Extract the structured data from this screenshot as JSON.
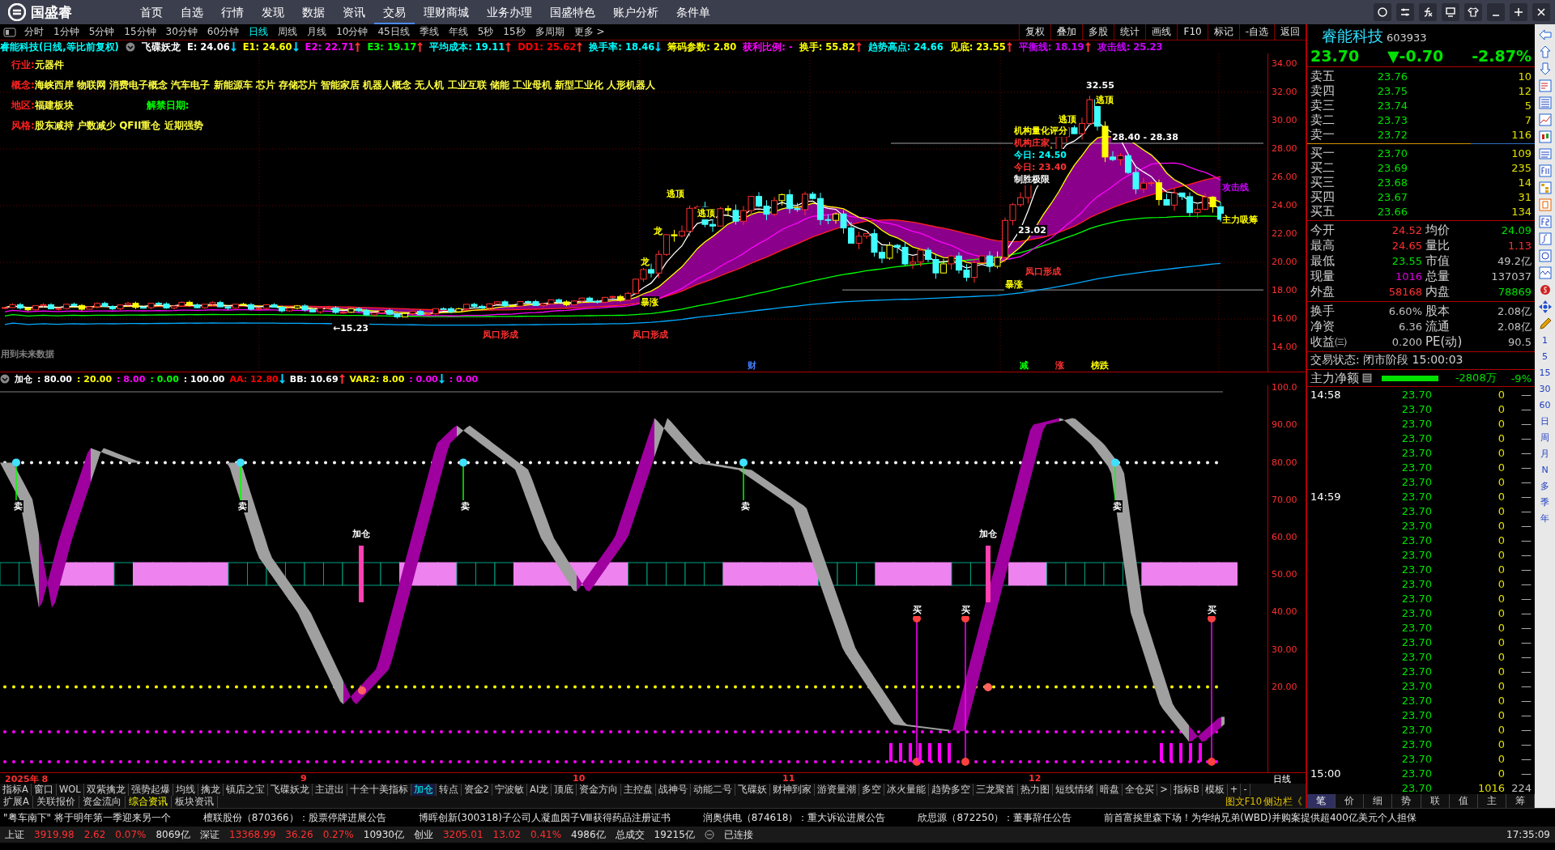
{
  "app": {
    "logo": "国盛睿"
  },
  "nav": [
    {
      "label": "首页",
      "selected": false
    },
    {
      "label": "自选",
      "selected": false
    },
    {
      "label": "行情",
      "selected": false
    },
    {
      "label": "发现",
      "selected": false
    },
    {
      "label": "数据",
      "selected": false
    },
    {
      "label": "资讯",
      "selected": false
    },
    {
      "label": "交易",
      "selected": true
    },
    {
      "label": "理财商城",
      "selected": false
    },
    {
      "label": "业务办理",
      "selected": false
    },
    {
      "label": "国盛特色",
      "selected": false
    },
    {
      "label": "账户分析",
      "selected": false
    },
    {
      "label": "条件单",
      "selected": false
    }
  ],
  "periods": [
    {
      "label": "分时",
      "selected": false
    },
    {
      "label": "1分钟",
      "selected": false
    },
    {
      "label": "5分钟",
      "selected": false
    },
    {
      "label": "15分钟",
      "selected": false
    },
    {
      "label": "30分钟",
      "selected": false
    },
    {
      "label": "60分钟",
      "selected": false
    },
    {
      "label": "日线",
      "selected": true
    },
    {
      "label": "周线",
      "selected": false
    },
    {
      "label": "月线",
      "selected": false
    },
    {
      "label": "10分钟",
      "selected": false
    },
    {
      "label": "45日线",
      "selected": false
    },
    {
      "label": "季线",
      "selected": false
    },
    {
      "label": "年线",
      "selected": false
    },
    {
      "label": "5秒",
      "selected": false
    },
    {
      "label": "15秒",
      "selected": false
    },
    {
      "label": "多周期",
      "selected": false
    },
    {
      "label": "更多 >",
      "selected": false
    }
  ],
  "chart_tools": [
    "复权",
    "叠加",
    "多股",
    "统计",
    "画线",
    "F10",
    "标记",
    "-自选",
    "返回"
  ],
  "info_bar": {
    "title": "睿能科技(日线,等比前复权)",
    "indicator": "飞碟妖龙",
    "items": [
      {
        "text": "E: 24.06",
        "color": "#ffffff",
        "rising": false
      },
      {
        "text": "E1: 24.60",
        "color": "#ffff00",
        "rising": false
      },
      {
        "text": "E2: 22.71",
        "color": "#ff00ff",
        "rising": true
      },
      {
        "text": "E3: 19.17",
        "color": "#00ff00",
        "rising": true
      },
      {
        "text": "平均成本: 19.11",
        "color": "#00ffff",
        "rising": true
      },
      {
        "text": "DD1: 25.62",
        "color": "#ff0000",
        "rising": true
      },
      {
        "text": "换手率: 18.46",
        "color": "#00ffff",
        "rising": false
      },
      {
        "text": "筹码参数: 2.80",
        "color": "#ffff00"
      },
      {
        "text": "获利比例: -",
        "color": "#ff00ff"
      },
      {
        "text": "换手: 55.82",
        "color": "#ffff00",
        "rising": true
      },
      {
        "text": "趋势高点: 24.66",
        "color": "#00ffff"
      },
      {
        "text": "见底: 23.55",
        "color": "#ffff00",
        "rising": true
      },
      {
        "text": "平衡线: 18.19",
        "color": "#cc00ff",
        "rising": true
      },
      {
        "text": "攻击线: 25.23",
        "color": "#cc00ff"
      }
    ]
  },
  "stock_tags": [
    {
      "label": "行业:",
      "value": "元器件"
    },
    {
      "label": "概念:",
      "value": "海峡西岸 物联网 消费电子概念 汽车电子 新能源车 芯片 存储芯片 智能家居 机器人概念 无人机 工业互联 储能 工业母机 新型工业化 人形机器人"
    },
    {
      "label": "地区:",
      "value": "福建板块",
      "extra": "解禁日期:"
    },
    {
      "label": "风格:",
      "value": "股东减持 户数减少 QFII重仓 近期强势"
    }
  ],
  "price_axis": [
    "34.00",
    "32.00",
    "30.00",
    "28.00",
    "26.00",
    "24.00",
    "22.00",
    "20.00",
    "18.00",
    "16.00",
    "14.00"
  ],
  "annotations": [
    {
      "text": "32.55",
      "color": "#ffffff"
    },
    {
      "text": "28.40 - 28.38",
      "color": "#ffffff"
    },
    {
      "text": "逃顶",
      "color": "#ffff00"
    },
    {
      "text": "逃顶",
      "color": "#ffff00"
    },
    {
      "text": "逃顶",
      "color": "#ffff00"
    },
    {
      "text": "逃顶",
      "color": "#ffff00"
    },
    {
      "text": "机构量化评分",
      "color": "#ffff00"
    },
    {
      "text": "机构庄家",
      "color": "#ff3030"
    },
    {
      "text": "今日: 24.50",
      "color": "#00ffff"
    },
    {
      "text": "今日: 23.40",
      "color": "#ff3030"
    },
    {
      "text": "制胜极限",
      "color": "#ffffff"
    },
    {
      "text": "攻击线",
      "color": "#cc00ff"
    },
    {
      "text": "主力吸筹",
      "color": "#ffff00"
    },
    {
      "text": "23.02",
      "color": "#ffffff"
    },
    {
      "text": "←15.23",
      "color": "#ffffff"
    },
    {
      "text": "凤口形成",
      "color": "#ff3030"
    },
    {
      "text": "凤口形成",
      "color": "#ff3030"
    },
    {
      "text": "凤口形成",
      "color": "#ff3030"
    },
    {
      "text": "暴涨",
      "color": "#ffff00"
    },
    {
      "text": "暴涨",
      "color": "#ffff00"
    },
    {
      "text": "龙",
      "color": "#ffff00"
    },
    {
      "text": "龙",
      "color": "#ffff00"
    },
    {
      "text": "用到未来数据",
      "color": "#808080"
    },
    {
      "text": "财",
      "color": "#4080ff"
    },
    {
      "text": "减",
      "color": "#00ff00"
    },
    {
      "text": "涨",
      "color": "#ff3030"
    },
    {
      "text": "榜跌",
      "color": "#ffff00"
    }
  ],
  "indicator_bar": {
    "name": "加仓",
    "items": [
      {
        "text": ": 80.00",
        "color": "#ffffff"
      },
      {
        "text": ": 20.00",
        "color": "#ffff00"
      },
      {
        "text": ": 8.00",
        "color": "#ff00ff"
      },
      {
        "text": ": 0.00",
        "color": "#00ff00"
      },
      {
        "text": ": 100.00",
        "color": "#ffffff"
      },
      {
        "text": "AA: 12.80",
        "color": "#ff0000",
        "rising": false
      },
      {
        "text": "BB: 10.69",
        "color": "#ffffff",
        "rising": true
      },
      {
        "text": "VAR2: 8.00",
        "color": "#ffff00"
      },
      {
        "text": ": 0.00",
        "color": "#ff00ff",
        "rising": false
      },
      {
        "text": ": 0.00",
        "color": "#ff00ff"
      }
    ]
  },
  "indicator_axis": [
    "100.0",
    "90.00",
    "80.00",
    "70.00",
    "60.00",
    "50.00",
    "40.00",
    "30.00",
    "20.00"
  ],
  "signals": [
    {
      "text": "卖",
      "kind": "sell"
    },
    {
      "text": "卖",
      "kind": "sell"
    },
    {
      "text": "卖",
      "kind": "sell"
    },
    {
      "text": "卖",
      "kind": "sell"
    },
    {
      "text": "卖",
      "kind": "sell"
    },
    {
      "text": "加仓",
      "kind": "add"
    },
    {
      "text": "加仓",
      "kind": "add"
    },
    {
      "text": "买",
      "kind": "buy"
    },
    {
      "text": "买",
      "kind": "buy"
    },
    {
      "text": "买",
      "kind": "buy"
    }
  ],
  "date_axis": [
    "2025年 8",
    "9",
    "10",
    "11",
    "12"
  ],
  "period_label": "日线",
  "indicator_tabs": [
    {
      "label": "指标A",
      "selected": false
    },
    {
      "label": "窗口",
      "selected": false
    },
    {
      "label": "WOL",
      "selected": false
    },
    {
      "label": "双紫擒龙",
      "selected": false
    },
    {
      "label": "强势起爆",
      "selected": false
    },
    {
      "label": "均线",
      "selected": false
    },
    {
      "label": "擒龙",
      "selected": false
    },
    {
      "label": "镇店之宝",
      "selected": false
    },
    {
      "label": "飞碟妖龙",
      "selected": false
    },
    {
      "label": "主进出",
      "selected": false
    },
    {
      "label": "十全十美指标",
      "selected": false
    },
    {
      "label": "加仓",
      "selected": true
    },
    {
      "label": "转点",
      "selected": false
    },
    {
      "label": "资金2",
      "selected": false
    },
    {
      "label": "宁波敏",
      "selected": false
    },
    {
      "label": "AI龙",
      "selected": false
    },
    {
      "label": "顶底",
      "selected": false
    },
    {
      "label": "资金方向",
      "selected": false
    },
    {
      "label": "主控盘",
      "selected": false
    },
    {
      "label": "战神号",
      "selected": false
    },
    {
      "label": "动能二号",
      "selected": false
    },
    {
      "label": "飞碟妖",
      "selected": false
    },
    {
      "label": "财神到家",
      "selected": false
    },
    {
      "label": "游资量潮",
      "selected": false
    },
    {
      "label": "多空",
      "selected": false
    },
    {
      "label": "冰火量能",
      "selected": false
    },
    {
      "label": "趋势多空",
      "selected": false
    },
    {
      "label": "三龙聚首",
      "selected": false
    },
    {
      "label": "热力图",
      "selected": false
    },
    {
      "label": "短线情绪",
      "selected": false
    },
    {
      "label": "暗盘",
      "selected": false
    },
    {
      "label": "全仓买",
      "selected": false
    },
    {
      "label": ">",
      "selected": false
    },
    {
      "label": "指标B",
      "selected": false
    },
    {
      "label": "模板",
      "selected": false
    },
    {
      "label": "+",
      "selected": false
    },
    {
      "label": "-",
      "selected": false
    }
  ],
  "info_tabs": [
    {
      "label": "扩展A",
      "selected": false
    },
    {
      "label": "关联报价",
      "selected": false
    },
    {
      "label": "资金流向",
      "selected": false
    },
    {
      "label": "综合资讯",
      "selected": true
    },
    {
      "label": "板块资讯",
      "selected": false
    }
  ],
  "info_tabs_right": [
    "图文F10",
    "侧边栏《"
  ],
  "quote": {
    "name": "睿能科技",
    "code": "603933",
    "price": "23.70",
    "change": "▼-0.70",
    "change_pct": "-2.87%",
    "asks": [
      {
        "label": "卖五",
        "price": "23.76",
        "volume": "10"
      },
      {
        "label": "卖四",
        "price": "23.75",
        "volume": "12"
      },
      {
        "label": "卖三",
        "price": "23.74",
        "volume": "5"
      },
      {
        "label": "卖二",
        "price": "23.73",
        "volume": "7"
      },
      {
        "label": "卖一",
        "price": "23.72",
        "volume": "116"
      }
    ],
    "bids": [
      {
        "label": "买一",
        "price": "23.70",
        "volume": "109"
      },
      {
        "label": "买二",
        "price": "23.69",
        "volume": "235"
      },
      {
        "label": "买三",
        "price": "23.68",
        "volume": "14"
      },
      {
        "label": "买四",
        "price": "23.67",
        "volume": "31"
      },
      {
        "label": "买五",
        "price": "23.66",
        "volume": "134"
      }
    ],
    "stats": [
      {
        "label": "今开",
        "value": "24.52",
        "color": "#ff3030"
      },
      {
        "label": "均价",
        "value": "24.09",
        "color": "#00e000"
      },
      {
        "label": "最高",
        "value": "24.65",
        "color": "#ff3030"
      },
      {
        "label": "量比",
        "value": "1.13",
        "color": "#ff3030"
      },
      {
        "label": "最低",
        "value": "23.55",
        "color": "#00e000"
      },
      {
        "label": "市值",
        "value": "49.2亿",
        "color": "#c0c0c0"
      },
      {
        "label": "现量",
        "value": "1016",
        "color": "#e000e0"
      },
      {
        "label": "总量",
        "value": "137037",
        "color": "#c0c0c0"
      },
      {
        "label": "外盘",
        "value": "58168",
        "color": "#ff3030"
      },
      {
        "label": "内盘",
        "value": "78869",
        "color": "#00e000"
      }
    ],
    "fundamentals": [
      {
        "label": "换手",
        "value": "6.60%",
        "label2": "股本",
        "value2": "2.08亿"
      },
      {
        "label": "净资",
        "value": "6.36",
        "label2": "流通",
        "value2": "2.08亿"
      },
      {
        "label": "收益㈢",
        "value": "0.200",
        "label2": "PE(动)",
        "value2": "90.5"
      }
    ],
    "trade_state": "交易状态: 闭市阶段 15:00:03",
    "main_net": {
      "label": "主力净额",
      "amount": "-2808万",
      "pct": "-9%"
    }
  },
  "ticks": [
    {
      "time": "14:58",
      "price": "23.70",
      "volume": "0",
      "side": "—"
    },
    {
      "price": "23.70",
      "volume": "0",
      "side": "—"
    },
    {
      "price": "23.70",
      "volume": "0",
      "side": "—"
    },
    {
      "price": "23.70",
      "volume": "0",
      "side": "—"
    },
    {
      "price": "23.70",
      "volume": "0",
      "side": "—"
    },
    {
      "price": "23.70",
      "volume": "0",
      "side": "—"
    },
    {
      "price": "23.70",
      "volume": "0",
      "side": "—"
    },
    {
      "time": "14:59",
      "price": "23.70",
      "volume": "0",
      "side": "—"
    },
    {
      "price": "23.70",
      "volume": "0",
      "side": "—"
    },
    {
      "price": "23.70",
      "volume": "0",
      "side": "—"
    },
    {
      "price": "23.70",
      "volume": "0",
      "side": "—"
    },
    {
      "price": "23.70",
      "volume": "0",
      "side": "—"
    },
    {
      "price": "23.70",
      "volume": "0",
      "side": "—"
    },
    {
      "price": "23.70",
      "volume": "0",
      "side": "—"
    },
    {
      "price": "23.70",
      "volume": "0",
      "side": "—"
    },
    {
      "price": "23.70",
      "volume": "0",
      "side": "—"
    },
    {
      "price": "23.70",
      "volume": "0",
      "side": "—"
    },
    {
      "price": "23.70",
      "volume": "0",
      "side": "—"
    },
    {
      "price": "23.70",
      "volume": "0",
      "side": "—"
    },
    {
      "price": "23.70",
      "volume": "0",
      "side": "—"
    },
    {
      "price": "23.70",
      "volume": "0",
      "side": "—"
    },
    {
      "price": "23.70",
      "volume": "0",
      "side": "—"
    },
    {
      "price": "23.70",
      "volume": "0",
      "side": "—"
    },
    {
      "price": "23.70",
      "volume": "0",
      "side": "—"
    },
    {
      "price": "23.70",
      "volume": "0",
      "side": "—"
    },
    {
      "price": "23.70",
      "volume": "0",
      "side": "—"
    },
    {
      "time": "15:00",
      "price": "23.70",
      "volume": "0",
      "side": "—"
    },
    {
      "price": "23.70",
      "volume": "1016",
      "side": "224"
    }
  ],
  "side_tabs": [
    {
      "label": "笔",
      "selected": true
    },
    {
      "label": "价",
      "selected": false
    },
    {
      "label": "细",
      "selected": false
    },
    {
      "label": "势",
      "selected": false
    },
    {
      "label": "联",
      "selected": false
    },
    {
      "label": "值",
      "selected": false
    },
    {
      "label": "主",
      "selected": false
    },
    {
      "label": "筹",
      "selected": false
    }
  ],
  "strip_periods": [
    "1",
    "5",
    "15",
    "30",
    "60",
    "日",
    "周",
    "月",
    "N",
    "多",
    "季",
    "年"
  ],
  "news": [
    "\"粤车南下\" 将于明年第一季迎来另一个",
    "檀联股份（870366）：股票停牌进展公告",
    "博晖创新(300318)子公司人凝血因子Ⅷ获得药品注册证书",
    "润奥供电（874618）：重大诉讼进展公告",
    "欣思源（872250）：董事辞任公告",
    "前首富挨里森下场！为华纳兄弟(WBD)并购案提供超400亿美元个人担保"
  ],
  "status_bar": {
    "indices": [
      {
        "name": "上证",
        "value": "3919.98",
        "change": "2.62",
        "pct": "0.07%",
        "amount": "8069亿"
      },
      {
        "name": "深证",
        "value": "13368.99",
        "change": "36.26",
        "pct": "0.27%",
        "amount": "10930亿"
      },
      {
        "name": "创业",
        "value": "3205.01",
        "change": "13.02",
        "pct": "0.41%",
        "amount": "4986亿"
      }
    ],
    "total_label": "总成交",
    "total": "19215亿",
    "connection": "已连接",
    "time": "17:35:09"
  }
}
